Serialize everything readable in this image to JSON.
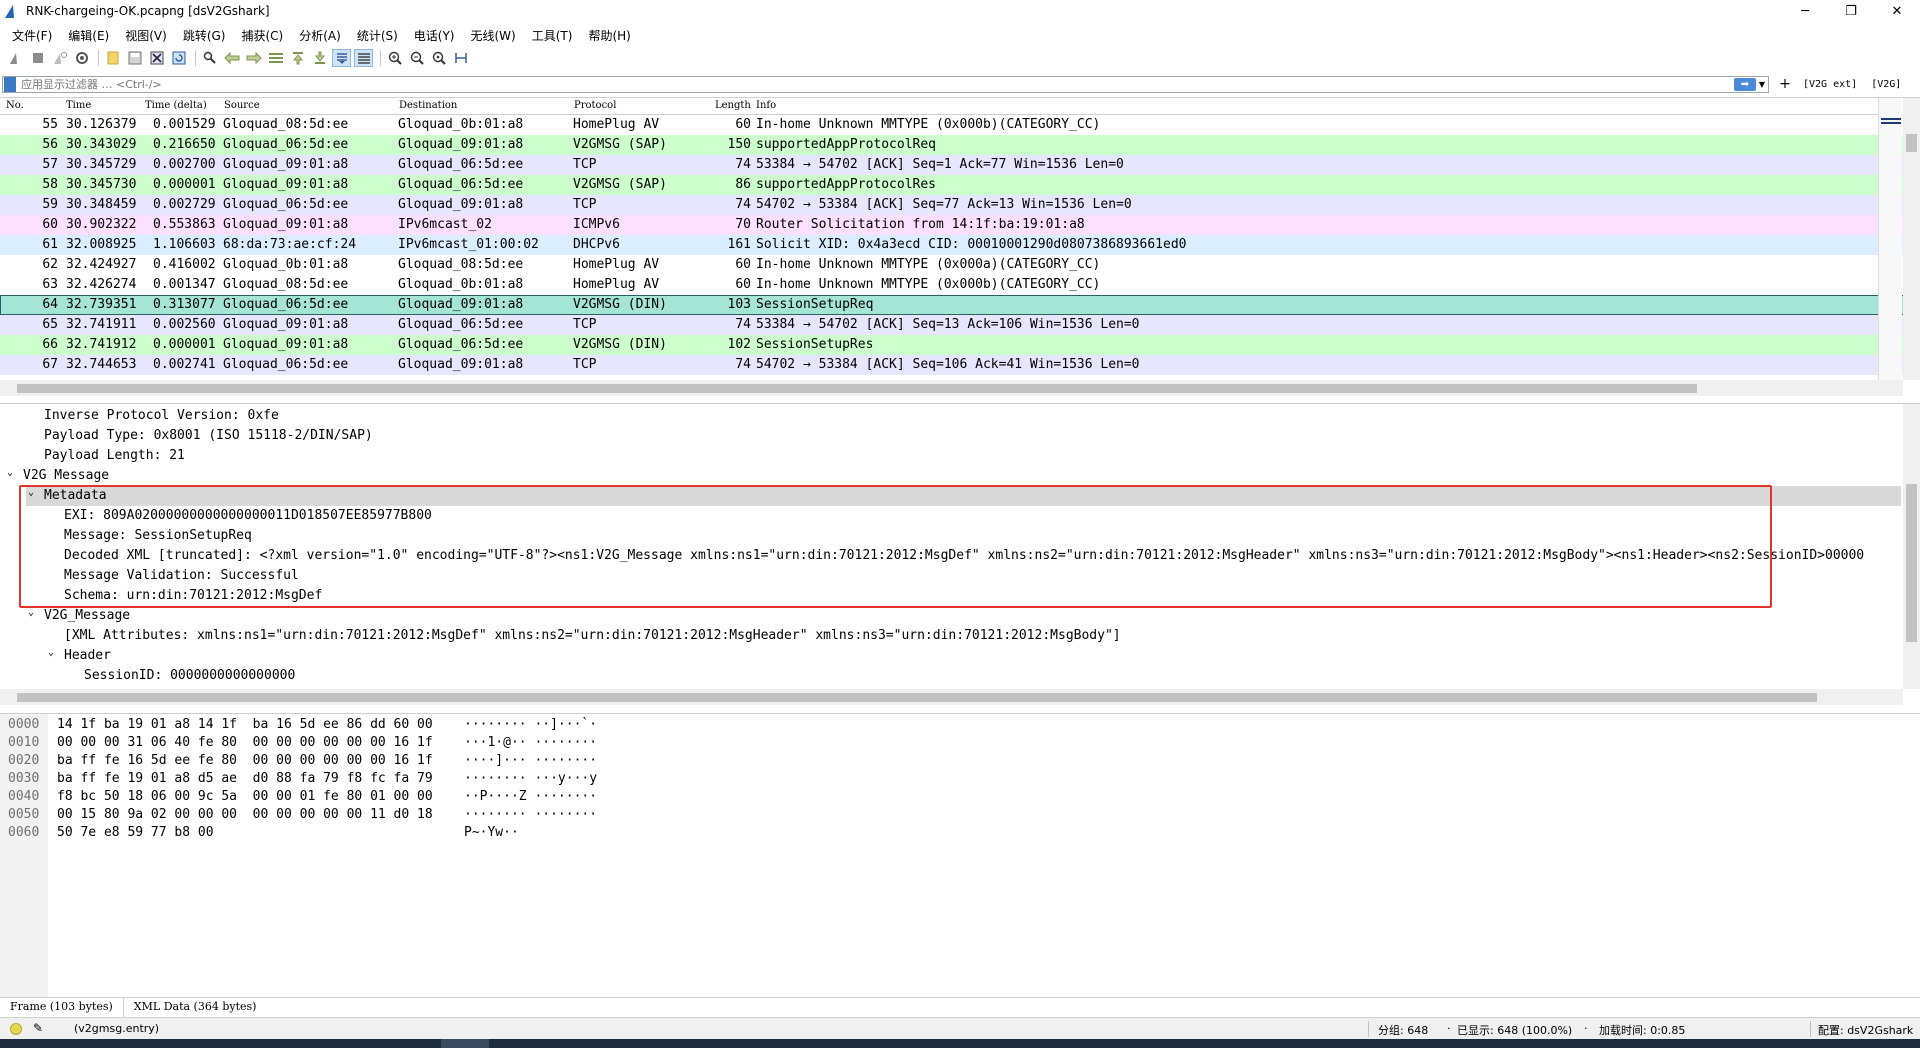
{
  "window": {
    "title": "RNK-chargeing-OK.pcapng [dsV2Gshark]",
    "controls": {
      "minimize": "─",
      "maximize": "❐",
      "close": "✕"
    }
  },
  "menu": [
    "文件(F)",
    "编辑(E)",
    "视图(V)",
    "跳转(G)",
    "捕获(C)",
    "分析(A)",
    "统计(S)",
    "电话(Y)",
    "无线(W)",
    "工具(T)",
    "帮助(H)"
  ],
  "toolbar_icons": [
    "shark-start-icon",
    "stop-icon",
    "restart-icon",
    "options-gear-icon",
    "open-file-icon",
    "save-file-icon",
    "close-file-icon",
    "reload-icon",
    "find-icon",
    "go-back-icon",
    "go-forward-icon",
    "go-to-packet-icon",
    "go-first-icon",
    "go-last-icon",
    "autoscroll-icon",
    "colorize-icon",
    "zoom-in-icon",
    "zoom-out-icon",
    "zoom-normal-icon",
    "resize-columns-icon"
  ],
  "filter": {
    "placeholder": "应用显示过滤器 … <Ctrl-/>",
    "plus": "+",
    "buttons": [
      "[V2G ext]",
      "[V2G]"
    ]
  },
  "packet_list": {
    "columns": [
      "No.",
      "Time",
      "Time (delta)",
      "Source",
      "Destination",
      "Protocol",
      "Length",
      "Info"
    ],
    "rows": [
      {
        "no": "55",
        "time": "30.126379",
        "delta": "0.001529",
        "src": "Gloquad_08:5d:ee",
        "dst": "Gloquad_0b:01:a8",
        "proto": "HomePlug AV",
        "len": "60",
        "info": "In-home Unknown MMTYPE (0x000b)(CATEGORY_CC)",
        "bg": "#ffffff"
      },
      {
        "no": "56",
        "time": "30.343029",
        "delta": "0.216650",
        "src": "Gloquad_06:5d:ee",
        "dst": "Gloquad_09:01:a8",
        "proto": "V2GMSG (SAP)",
        "len": "150",
        "info": "supportedAppProtocolReq",
        "bg": "#ccffcc"
      },
      {
        "no": "57",
        "time": "30.345729",
        "delta": "0.002700",
        "src": "Gloquad_09:01:a8",
        "dst": "Gloquad_06:5d:ee",
        "proto": "TCP",
        "len": "74",
        "info": "53384 → 54702 [ACK] Seq=1 Ack=77 Win=1536 Len=0",
        "bg": "#e7e6ff"
      },
      {
        "no": "58",
        "time": "30.345730",
        "delta": "0.000001",
        "src": "Gloquad_09:01:a8",
        "dst": "Gloquad_06:5d:ee",
        "proto": "V2GMSG (SAP)",
        "len": "86",
        "info": "supportedAppProtocolRes",
        "bg": "#ccffcc"
      },
      {
        "no": "59",
        "time": "30.348459",
        "delta": "0.002729",
        "src": "Gloquad_06:5d:ee",
        "dst": "Gloquad_09:01:a8",
        "proto": "TCP",
        "len": "74",
        "info": "54702 → 53384 [ACK] Seq=77 Ack=13 Win=1536 Len=0",
        "bg": "#e7e6ff"
      },
      {
        "no": "60",
        "time": "30.902322",
        "delta": "0.553863",
        "src": "Gloquad_09:01:a8",
        "dst": "IPv6mcast_02",
        "proto": "ICMPv6",
        "len": "70",
        "info": "Router Solicitation from 14:1f:ba:19:01:a8",
        "bg": "#fce0ff"
      },
      {
        "no": "61",
        "time": "32.008925",
        "delta": "1.106603",
        "src": "68:da:73:ae:cf:24",
        "dst": "IPv6mcast_01:00:02",
        "proto": "DHCPv6",
        "len": "161",
        "info": "Solicit XID: 0x4a3ecd CID: 00010001290d0807386893661ed0",
        "bg": "#daeeff"
      },
      {
        "no": "62",
        "time": "32.424927",
        "delta": "0.416002",
        "src": "Gloquad_0b:01:a8",
        "dst": "Gloquad_08:5d:ee",
        "proto": "HomePlug AV",
        "len": "60",
        "info": "In-home Unknown MMTYPE (0x000a)(CATEGORY_CC)",
        "bg": "#ffffff"
      },
      {
        "no": "63",
        "time": "32.426274",
        "delta": "0.001347",
        "src": "Gloquad_08:5d:ee",
        "dst": "Gloquad_0b:01:a8",
        "proto": "HomePlug AV",
        "len": "60",
        "info": "In-home Unknown MMTYPE (0x000b)(CATEGORY_CC)",
        "bg": "#ffffff"
      },
      {
        "no": "64",
        "time": "32.739351",
        "delta": "0.313077",
        "src": "Gloquad_06:5d:ee",
        "dst": "Gloquad_09:01:a8",
        "proto": "V2GMSG (DIN)",
        "len": "103",
        "info": "SessionSetupReq",
        "bg": "#a4e5d5",
        "selected": true
      },
      {
        "no": "65",
        "time": "32.741911",
        "delta": "0.002560",
        "src": "Gloquad_09:01:a8",
        "dst": "Gloquad_06:5d:ee",
        "proto": "TCP",
        "len": "74",
        "info": "53384 → 54702 [ACK] Seq=13 Ack=106 Win=1536 Len=0",
        "bg": "#e7e6ff"
      },
      {
        "no": "66",
        "time": "32.741912",
        "delta": "0.000001",
        "src": "Gloquad_09:01:a8",
        "dst": "Gloquad_06:5d:ee",
        "proto": "V2GMSG (DIN)",
        "len": "102",
        "info": "SessionSetupRes",
        "bg": "#ccffcc"
      },
      {
        "no": "67",
        "time": "32.744653",
        "delta": "0.002741",
        "src": "Gloquad_06:5d:ee",
        "dst": "Gloquad_09:01:a8",
        "proto": "TCP",
        "len": "74",
        "info": "54702 → 53384 [ACK] Seq=106 Ack=41 Win=1536 Len=0",
        "bg": "#e7e6ff"
      }
    ]
  },
  "details": [
    {
      "indent": 0,
      "arrow": "",
      "text": "Inverse Protocol Version: 0xfe"
    },
    {
      "indent": 0,
      "arrow": "",
      "text": "Payload Type: 0x8001 (ISO 15118-2/DIN/SAP)"
    },
    {
      "indent": 0,
      "arrow": "",
      "text": "Payload Length: 21"
    },
    {
      "indent": -1,
      "arrow": "⌄",
      "text": "V2G Message"
    },
    {
      "indent": 0,
      "arrow": "⌄",
      "text": "Metadata",
      "highlight": true
    },
    {
      "indent": 1,
      "arrow": "",
      "text": "EXI: 809A02000000000000000011D018507EE85977B800"
    },
    {
      "indent": 1,
      "arrow": "",
      "text": "Message: SessionSetupReq"
    },
    {
      "indent": 1,
      "arrow": "",
      "text": "Decoded XML [truncated]: <?xml version=\"1.0\" encoding=\"UTF-8\"?><ns1:V2G_Message xmlns:ns1=\"urn:din:70121:2012:MsgDef\" xmlns:ns2=\"urn:din:70121:2012:MsgHeader\" xmlns:ns3=\"urn:din:70121:2012:MsgBody\"><ns1:Header><ns2:SessionID>00000"
    },
    {
      "indent": 1,
      "arrow": "",
      "text": "Message Validation: Successful"
    },
    {
      "indent": 1,
      "arrow": "",
      "text": "Schema: urn:din:70121:2012:MsgDef"
    },
    {
      "indent": 0,
      "arrow": "⌄",
      "text": "V2G_Message"
    },
    {
      "indent": 1,
      "arrow": "",
      "text": "[XML Attributes:  xmlns:ns1=\"urn:din:70121:2012:MsgDef\" xmlns:ns2=\"urn:din:70121:2012:MsgHeader\" xmlns:ns3=\"urn:din:70121:2012:MsgBody\"]"
    },
    {
      "indent": 1,
      "arrow": "⌄",
      "text": "Header"
    },
    {
      "indent": 2,
      "arrow": "",
      "text": "SessionID: 0000000000000000"
    }
  ],
  "bytes": [
    {
      "off": "0000",
      "hex": "14 1f ba 19 01 a8 14 1f  ba 16 5d ee 86 dd 60 00",
      "ascii": "········ ··]···`·"
    },
    {
      "off": "0010",
      "hex": "00 00 00 31 06 40 fe 80  00 00 00 00 00 00 16 1f",
      "ascii": "···1·@·· ········"
    },
    {
      "off": "0020",
      "hex": "ba ff fe 16 5d ee fe 80  00 00 00 00 00 00 16 1f",
      "ascii": "····]··· ········"
    },
    {
      "off": "0030",
      "hex": "ba ff fe 19 01 a8 d5 ae  d0 88 fa 79 f8 fc fa 79",
      "ascii": "········ ···y···y"
    },
    {
      "off": "0040",
      "hex": "f8 bc 50 18 06 00 9c 5a  00 00 01 fe 80 01 00 00",
      "ascii": "··P····Z ········"
    },
    {
      "off": "0050",
      "hex": "00 15 80 9a 02 00 00 00  00 00 00 00 00 11 d0 18",
      "ascii": "········ ········"
    },
    {
      "off": "0060",
      "hex": "50 7e e8 59 77 b8 00",
      "ascii": "P~·Yw··"
    }
  ],
  "byte_tabs": [
    "Frame (103 bytes)",
    "XML Data (364 bytes)"
  ],
  "status": {
    "field": "(v2gmsg.entry)",
    "packets": "分组: 648",
    "displayed": "已显示: 648 (100.0%)",
    "load_time": "加载时间: 0:0.85",
    "profile": "配置: dsV2Gshark"
  }
}
